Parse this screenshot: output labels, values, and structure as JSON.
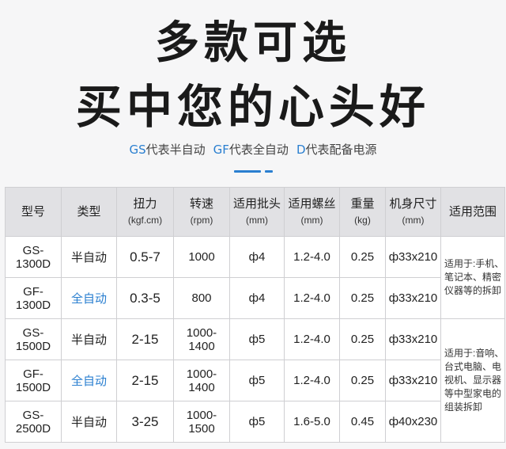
{
  "headline": {
    "line1": "多款可选",
    "line2": "买中您的心头好"
  },
  "legend": {
    "gs_code": "GS",
    "gs_text": "代表半自动",
    "gf_code": "GF",
    "gf_text": "代表全自动",
    "d_code": "D",
    "d_text": "代表配备电源"
  },
  "colors": {
    "accent": "#2a7fd0",
    "header_bg": "#e1e1e4",
    "page_bg": "#f6f6f7"
  },
  "table": {
    "headers": [
      {
        "label": "型号",
        "unit": ""
      },
      {
        "label": "类型",
        "unit": ""
      },
      {
        "label": "扭力",
        "unit": "(kgf.cm)"
      },
      {
        "label": "转速",
        "unit": "(rpm)"
      },
      {
        "label": "适用批头",
        "unit": "(mm)"
      },
      {
        "label": "适用螺丝",
        "unit": "(mm)"
      },
      {
        "label": "重量",
        "unit": "(kg)"
      },
      {
        "label": "机身尺寸",
        "unit": "(mm)"
      },
      {
        "label": "适用范围",
        "unit": ""
      }
    ],
    "rows": [
      {
        "model": "GS-1300D",
        "type": "半自动",
        "auto": false,
        "torque": "0.5-7",
        "speed": "1000",
        "bit": "ф4",
        "screw": "1.2-4.0",
        "weight": "0.25",
        "size": "ф33x210"
      },
      {
        "model": "GF-1300D",
        "type": "全自动",
        "auto": true,
        "torque": "0.3-5",
        "speed": "800",
        "bit": "ф4",
        "screw": "1.2-4.0",
        "weight": "0.25",
        "size": "ф33x210"
      },
      {
        "model": "GS-1500D",
        "type": "半自动",
        "auto": false,
        "torque": "2-15",
        "speed": "1000-1400",
        "bit": "ф5",
        "screw": "1.2-4.0",
        "weight": "0.25",
        "size": "ф33x210"
      },
      {
        "model": "GF-1500D",
        "type": "全自动",
        "auto": true,
        "torque": "2-15",
        "speed": "1000-1400",
        "bit": "ф5",
        "screw": "1.2-4.0",
        "weight": "0.25",
        "size": "ф33x210"
      },
      {
        "model": "GS-2500D",
        "type": "半自动",
        "auto": false,
        "torque": "3-25",
        "speed": "1000-1500",
        "bit": "ф5",
        "screw": "1.6-5.0",
        "weight": "0.45",
        "size": "ф40x230"
      }
    ],
    "scope_small": "适用于:手机、笔记本、精密仪器等的拆卸",
    "scope_large": "适用于:音响、台式电脑、电视机、显示器等中型家电的组装拆卸"
  }
}
